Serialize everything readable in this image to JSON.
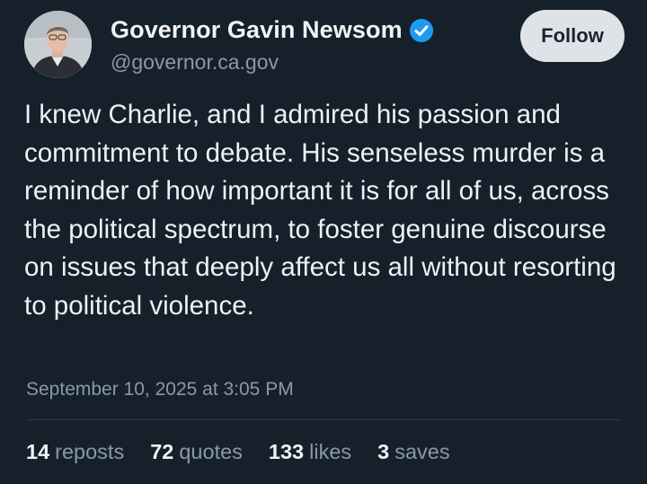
{
  "author": {
    "name": "Governor Gavin Newsom",
    "handle": "@governor.ca.gov",
    "verified": true,
    "avatar_icon": "person-avatar",
    "verified_icon": "verified-badge-icon",
    "verified_color": "#1d9bf0"
  },
  "follow_label": "Follow",
  "post": {
    "text": "I knew Charlie, and I admired his passion and commitment to debate. His senseless murder is a reminder of how important it is for all of us, across the political spectrum, to foster genuine discourse on issues that deeply affect us all without resorting to political violence.",
    "timestamp": "September 10, 2025 at 3:05 PM"
  },
  "stats": {
    "reposts": {
      "count": "14",
      "label": "reposts"
    },
    "quotes": {
      "count": "72",
      "label": "quotes"
    },
    "likes": {
      "count": "133",
      "label": "likes"
    },
    "saves": {
      "count": "3",
      "label": "saves"
    }
  },
  "colors": {
    "background": "#16202b",
    "muted_text": "#8a98a8",
    "button_bg": "#dfe3e8"
  }
}
